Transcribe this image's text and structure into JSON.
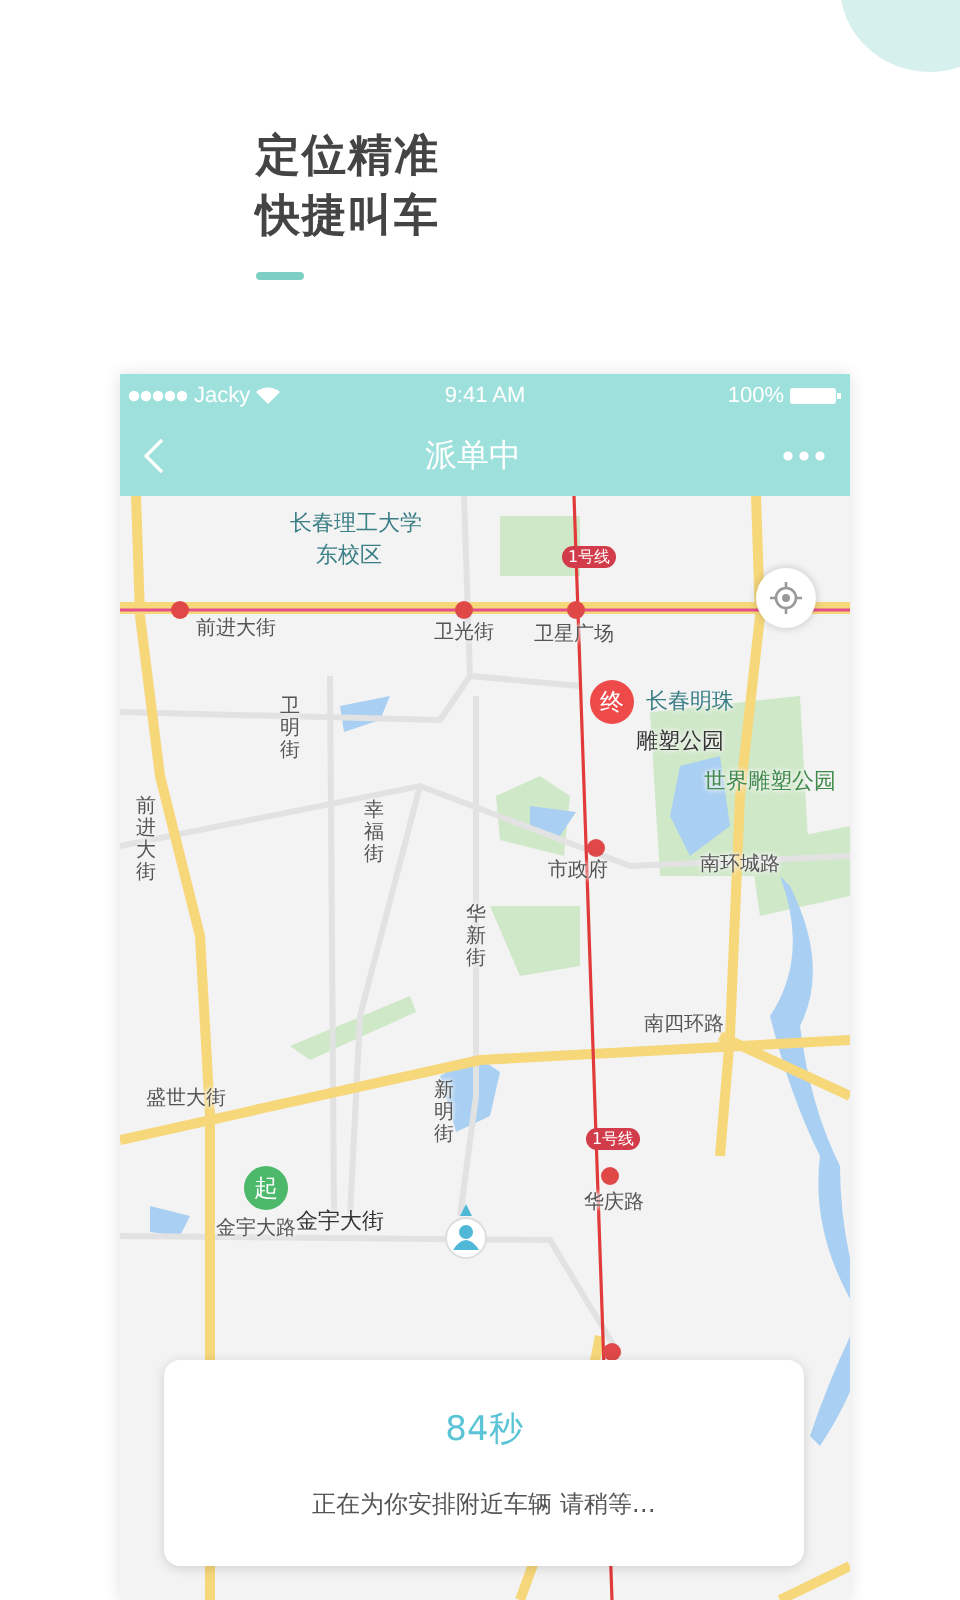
{
  "headline": [
    "定位精准",
    "快捷叫车"
  ],
  "status_bar": {
    "carrier": "Jacky",
    "time": "9:41 AM",
    "battery": "100%"
  },
  "nav": {
    "title": "派单中"
  },
  "map": {
    "labels": [
      {
        "text": "长春理工大学",
        "kind": "poi"
      },
      {
        "text": "东校区",
        "kind": "poi"
      },
      {
        "text": "1号线",
        "kind": "badge"
      },
      {
        "text": "前进大街",
        "kind": "road"
      },
      {
        "text": "卫光街",
        "kind": "road"
      },
      {
        "text": "卫星广场",
        "kind": "road"
      },
      {
        "text": "长春明珠",
        "kind": "poi"
      },
      {
        "text": "雕塑公园",
        "kind": "place"
      },
      {
        "text": "世界雕塑公园",
        "kind": "park"
      },
      {
        "text": "卫明街",
        "kind": "vertical"
      },
      {
        "text": "前进大街",
        "kind": "vertical"
      },
      {
        "text": "幸福街",
        "kind": "vertical"
      },
      {
        "text": "市政府",
        "kind": "road"
      },
      {
        "text": "南环城路",
        "kind": "road"
      },
      {
        "text": "华新街",
        "kind": "vertical"
      },
      {
        "text": "南四环路",
        "kind": "road"
      },
      {
        "text": "盛世大街",
        "kind": "road"
      },
      {
        "text": "新明街",
        "kind": "vertical"
      },
      {
        "text": "1号线",
        "kind": "badge"
      },
      {
        "text": "华庆路",
        "kind": "road"
      },
      {
        "text": "金宇大路",
        "kind": "road"
      },
      {
        "text": "金宇大街",
        "kind": "place"
      }
    ],
    "pins": [
      {
        "kind": "end",
        "text": "终"
      },
      {
        "kind": "start",
        "text": "起"
      }
    ]
  },
  "card": {
    "countdown": "84秒",
    "message": "正在为你安排附近车辆 请稍等…"
  }
}
